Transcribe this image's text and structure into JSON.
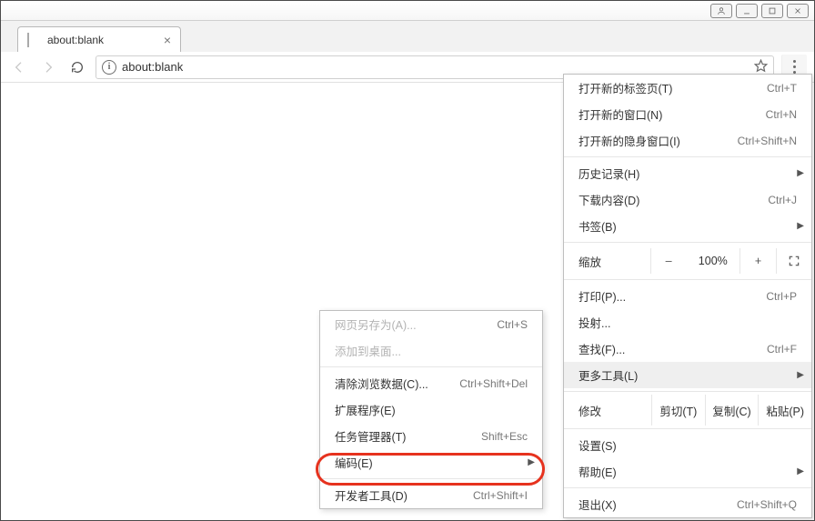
{
  "window_controls": {
    "user": "user",
    "min": "min",
    "max": "max",
    "close": "close"
  },
  "tab": {
    "title": "about:blank"
  },
  "toolbar": {
    "url": "about:blank"
  },
  "main_menu": {
    "new_tab": {
      "label": "打开新的标签页(T)",
      "shortcut": "Ctrl+T"
    },
    "new_window": {
      "label": "打开新的窗口(N)",
      "shortcut": "Ctrl+N"
    },
    "new_incognito": {
      "label": "打开新的隐身窗口(I)",
      "shortcut": "Ctrl+Shift+N"
    },
    "history": {
      "label": "历史记录(H)"
    },
    "downloads": {
      "label": "下载内容(D)",
      "shortcut": "Ctrl+J"
    },
    "bookmarks": {
      "label": "书签(B)"
    },
    "zoom": {
      "label": "缩放",
      "value": "100%",
      "minus": "–",
      "plus": "+"
    },
    "print": {
      "label": "打印(P)...",
      "shortcut": "Ctrl+P"
    },
    "cast": {
      "label": "投射..."
    },
    "find": {
      "label": "查找(F)...",
      "shortcut": "Ctrl+F"
    },
    "more_tools": {
      "label": "更多工具(L)"
    },
    "edit": {
      "label": "修改",
      "cut": "剪切(T)",
      "copy": "复制(C)",
      "paste": "粘贴(P)"
    },
    "settings": {
      "label": "设置(S)"
    },
    "help": {
      "label": "帮助(E)"
    },
    "exit": {
      "label": "退出(X)",
      "shortcut": "Ctrl+Shift+Q"
    }
  },
  "sub_menu": {
    "save_as": {
      "label": "网页另存为(A)...",
      "shortcut": "Ctrl+S"
    },
    "add_desktop": {
      "label": "添加到桌面..."
    },
    "clear_data": {
      "label": "清除浏览数据(C)...",
      "shortcut": "Ctrl+Shift+Del"
    },
    "extensions": {
      "label": "扩展程序(E)"
    },
    "task_manager": {
      "label": "任务管理器(T)",
      "shortcut": "Shift+Esc"
    },
    "encoding": {
      "label": "编码(E)"
    },
    "dev_tools": {
      "label": "开发者工具(D)",
      "shortcut": "Ctrl+Shift+I"
    }
  }
}
